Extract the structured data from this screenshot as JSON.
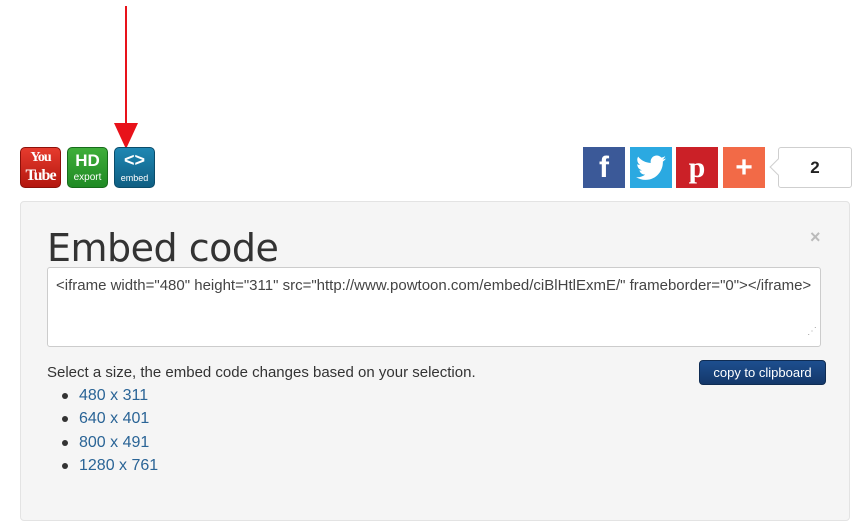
{
  "export_icons": {
    "youtube": {
      "line1": "You",
      "line2": "Tube"
    },
    "hd_export": {
      "line1": "HD",
      "line2": "export"
    },
    "embed": {
      "line1": "<>",
      "line2": "embed"
    }
  },
  "share": {
    "facebook_glyph": "f",
    "pinterest_glyph": "p",
    "more_glyph": "+",
    "count": "2"
  },
  "panel": {
    "title": "Embed code",
    "close_glyph": "×",
    "code": "<iframe width=\"480\" height=\"311\" src=\"http://www.powtoon.com/embed/ciBlHtlExmE/\" frameborder=\"0\"></iframe>",
    "size_instruction": "Select a size, the embed code changes based on your selection.",
    "copy_button": "copy to clipboard",
    "sizes": [
      "480 x 311",
      "640 x 401",
      "800 x 491",
      "1280 x 761"
    ]
  },
  "colors": {
    "annotation_arrow": "#e8121a",
    "facebook": "#3b5998",
    "twitter": "#2ba9e1",
    "pinterest": "#cb2027",
    "addthis": "#f26a47",
    "copy_button": "#1d4f8f",
    "link": "#2a6496"
  },
  "icons": [
    "annotation-arrow-icon",
    "youtube-icon",
    "hd-export-icon",
    "embed-icon",
    "facebook-icon",
    "twitter-icon",
    "pinterest-icon",
    "plus-icon",
    "close-icon",
    "resize-grip-icon"
  ]
}
